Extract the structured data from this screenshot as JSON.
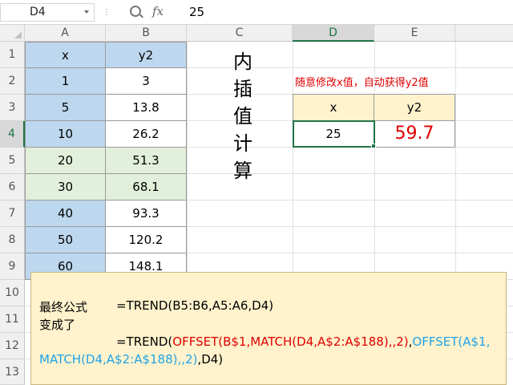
{
  "formula_bar": {
    "name_box": "D4",
    "fx_label": "fx",
    "value": "25"
  },
  "columns": [
    "A",
    "B",
    "C",
    "D",
    "E"
  ],
  "rows": [
    "1",
    "2",
    "3",
    "4",
    "5",
    "6",
    "7",
    "8",
    "9",
    "10",
    "11",
    "12",
    "13"
  ],
  "table": {
    "header": [
      "x",
      "y2"
    ],
    "rows": [
      [
        "1",
        "3"
      ],
      [
        "5",
        "13.8"
      ],
      [
        "10",
        "26.2"
      ],
      [
        "20",
        "51.3"
      ],
      [
        "30",
        "68.1"
      ],
      [
        "40",
        "93.3"
      ],
      [
        "50",
        "120.2"
      ],
      [
        "60",
        "148.1"
      ]
    ]
  },
  "title_chars": [
    "内",
    "插",
    "值",
    "计",
    "算"
  ],
  "hint": "随意修改x值，自动获得y2值",
  "calc": {
    "header": [
      "x",
      "y2"
    ],
    "x_value": "25",
    "y2_value": "59.7"
  },
  "note": {
    "label_line1": "最终公式",
    "label_line2": "变成了",
    "formula1": "=TREND(B5:B6,A5:A6,D4)",
    "f2_start": "=TREND(",
    "f2_offset_b": "OFFSET(B$1,MATCH(D4,A$2:A$188),,2)",
    "f2_comma": ",",
    "f2_offset_a_start": "OFFSET(A$1,",
    "f2_offset_a_end": "MATCH(D4,A$2:A$188),,2)",
    "f2_end": ",D4)"
  },
  "colors": {
    "selected_accent": "#217346",
    "result_red": "#e00000",
    "formula_cyan": "#1fa3e8",
    "note_bg": "#fff2cc",
    "blue_fill": "#bdd7ee",
    "green_fill": "#e2efda"
  }
}
